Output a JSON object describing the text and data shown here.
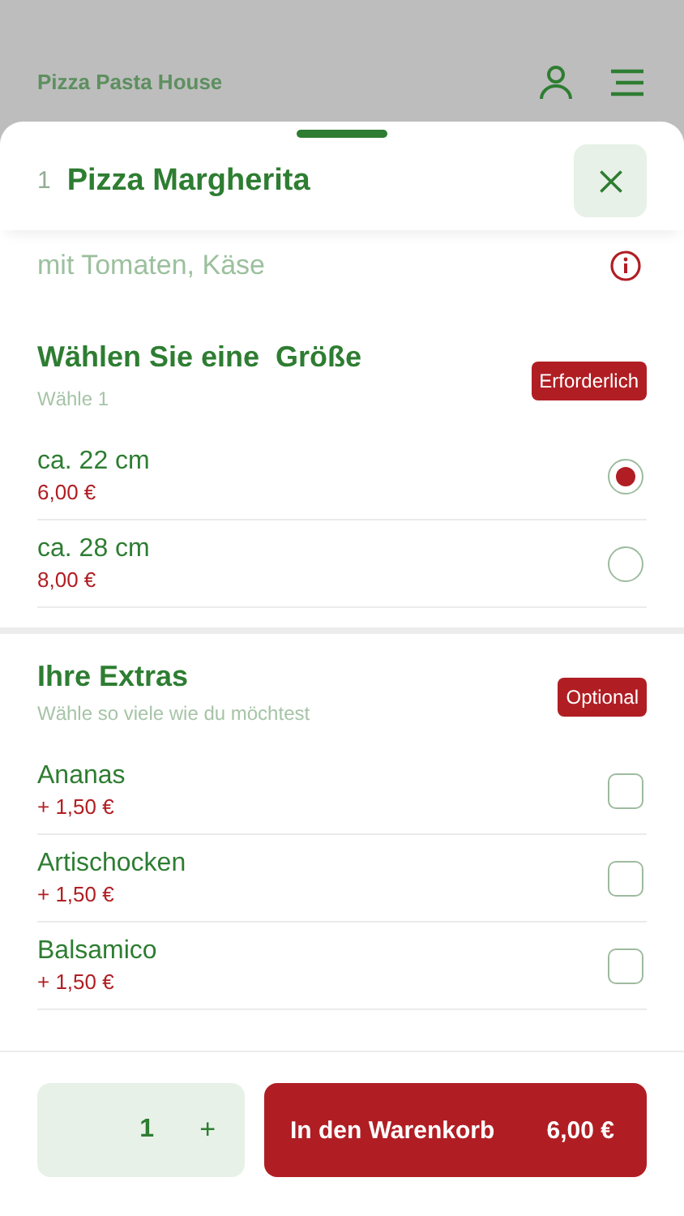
{
  "header": {
    "title": "Pizza Pasta House"
  },
  "sheet": {
    "number": "1",
    "title": "Pizza Margherita",
    "description": "mit Tomaten, Käse"
  },
  "sections": [
    {
      "kind": "radio",
      "title": "Wählen Sie eine  Größe",
      "subtitle": "Wähle 1",
      "badge": "Erforderlich",
      "options": [
        {
          "name": "ca. 22 cm",
          "price": "6,00 €",
          "selected": true
        },
        {
          "name": "ca. 28 cm",
          "price": "8,00 €",
          "selected": false
        }
      ]
    },
    {
      "kind": "checkbox",
      "title": "Ihre Extras",
      "subtitle": "Wähle so viele wie du möchtest",
      "badge": "Optional",
      "options": [
        {
          "name": "Ananas",
          "price": "+ 1,50 €",
          "checked": false
        },
        {
          "name": "Artischocken",
          "price": "+ 1,50 €",
          "checked": false
        },
        {
          "name": "Balsamico",
          "price": "+ 1,50 €",
          "checked": false
        }
      ]
    }
  ],
  "footer": {
    "quantity": "1",
    "plus": "+",
    "cart_label": "In den Warenkorb",
    "cart_price": "6,00 €"
  }
}
